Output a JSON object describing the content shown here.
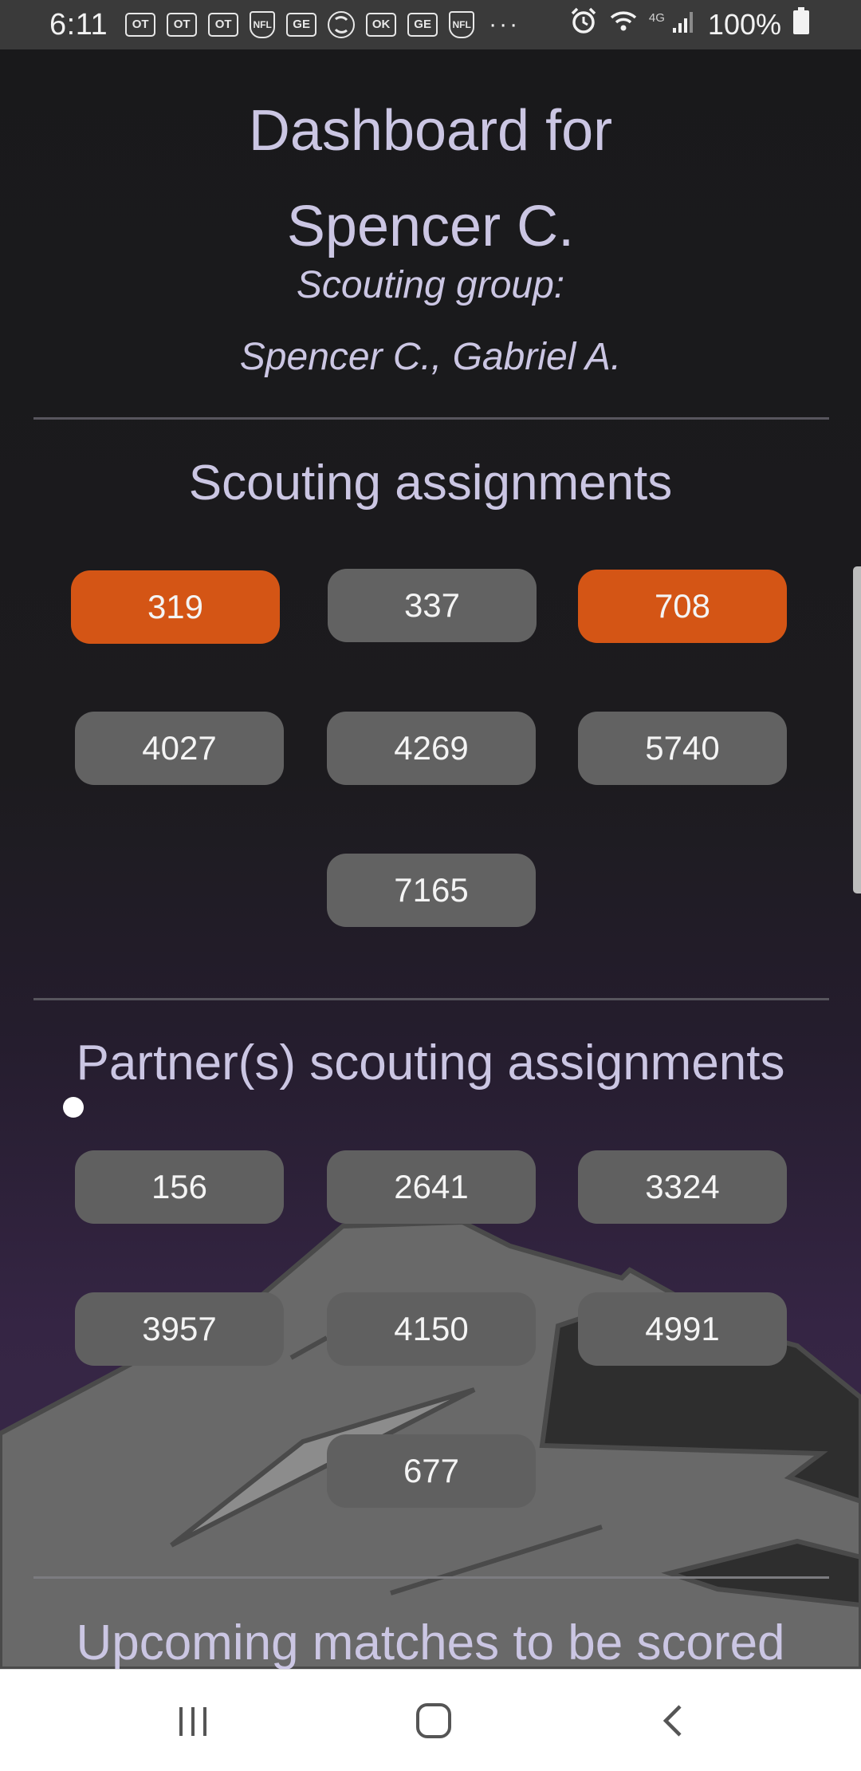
{
  "status_bar": {
    "time": "6:11",
    "notifications": [
      "OT",
      "OT",
      "OT",
      "NFL",
      "GE",
      "",
      "OK",
      "GE",
      "NFL"
    ],
    "more": "···",
    "network": "4G",
    "battery": "100%"
  },
  "header": {
    "title_line1": "Dashboard for",
    "title_line2": "Spencer C.",
    "group_label": "Scouting group:",
    "group_members": "Spencer C., Gabriel A."
  },
  "scouting": {
    "heading": "Scouting assignments",
    "teams": [
      {
        "number": "319",
        "active": true
      },
      {
        "number": "337",
        "active": false
      },
      {
        "number": "708",
        "active": true
      },
      {
        "number": "4027",
        "active": false
      },
      {
        "number": "4269",
        "active": false
      },
      {
        "number": "5740",
        "active": false
      },
      {
        "number": "7165",
        "active": false
      }
    ]
  },
  "partner": {
    "heading": "Partner(s) scouting assignments",
    "teams": [
      "156",
      "2641",
      "3324",
      "3957",
      "4150",
      "4991",
      "677"
    ]
  },
  "upcoming": {
    "heading": "Upcoming matches to be scored"
  },
  "colors": {
    "accent": "#d45515",
    "chip": "#626262",
    "text": "#cbc6e3"
  }
}
